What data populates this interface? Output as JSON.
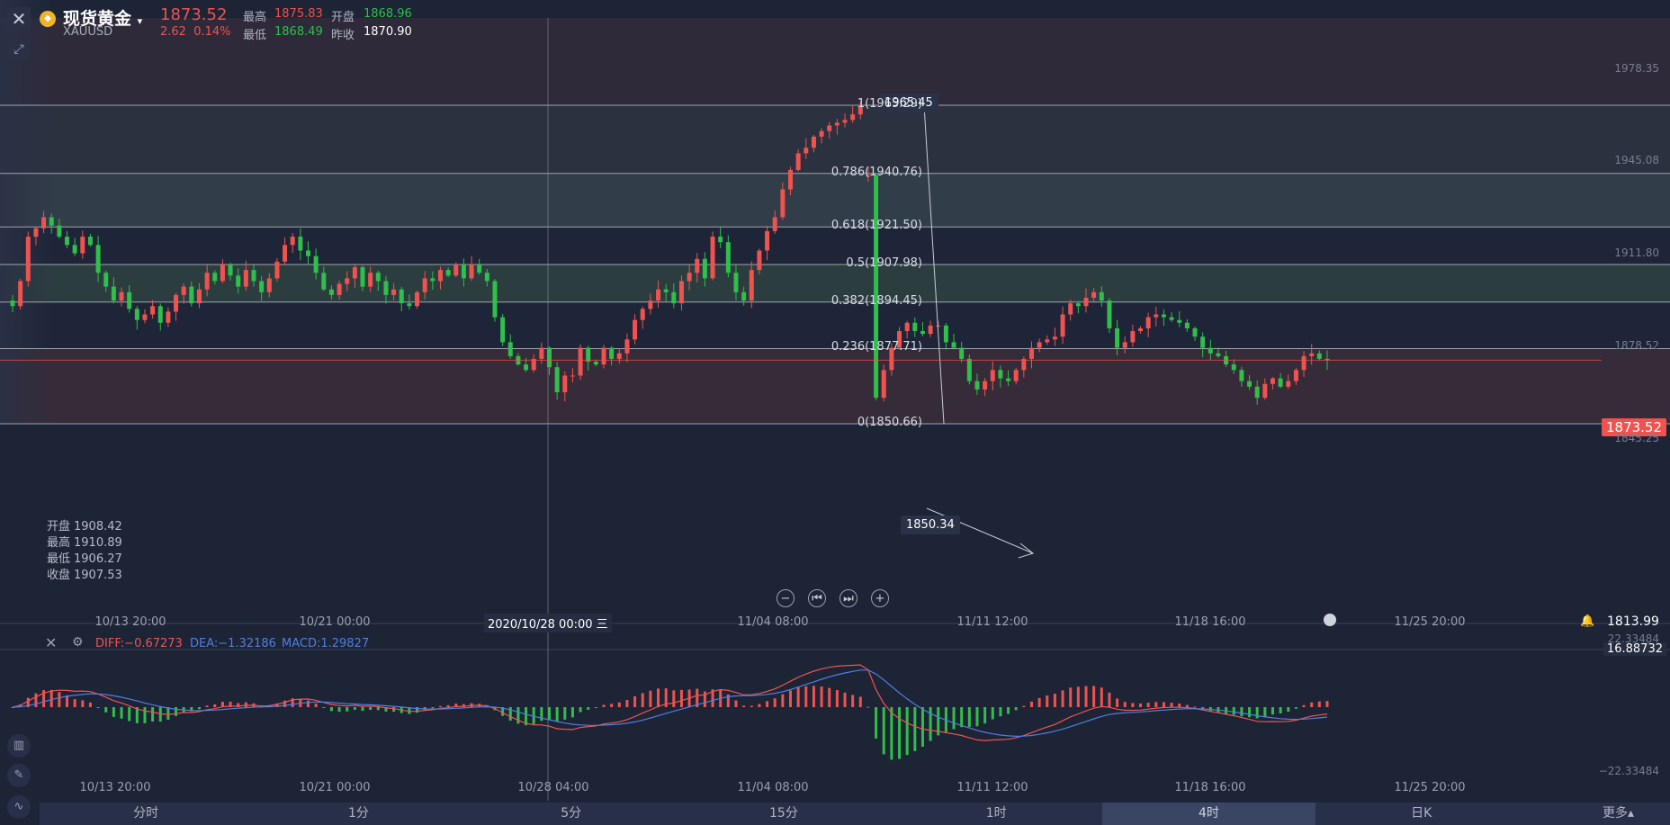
{
  "header": {
    "title": "现货黄金",
    "symbol": "XAUUSD",
    "price": "1873.52",
    "change": "2.62",
    "change_pct": "0.14%",
    "high_label": "最高",
    "high": "1875.83",
    "open_label": "开盘",
    "open": "1868.96",
    "low_label": "最低",
    "low": "1868.49",
    "prevclose_label": "昨收",
    "prevclose": "1870.90"
  },
  "ohlc_panel": [
    {
      "label": "开盘",
      "value": "1908.42"
    },
    {
      "label": "最高",
      "value": "1910.89"
    },
    {
      "label": "最低",
      "value": "1906.27"
    },
    {
      "label": "收盘",
      "value": "1907.53"
    }
  ],
  "fib": {
    "high_box": "1965.45",
    "low_box": "1850.34",
    "levels": [
      {
        "label": "1(1965.29)",
        "value": 1965.29
      },
      {
        "label": "0.786(1940.76)",
        "value": 1940.76
      },
      {
        "label": "0.618(1921.50)",
        "value": 1921.5
      },
      {
        "label": "0.5(1907.98)",
        "value": 1907.98
      },
      {
        "label": "0.382(1894.45)",
        "value": 1894.45
      },
      {
        "label": "0.236(1877.71)",
        "value": 1877.71
      },
      {
        "label": "0(1850.66)",
        "value": 1850.66
      }
    ]
  },
  "y_axis": [
    "1978.35",
    "1945.08",
    "1911.80",
    "1878.52",
    "1845.25"
  ],
  "current_price_tag": "1873.52",
  "crosshair": {
    "date_label": "2020/10/28 00:00 三",
    "y_value": "1813.99"
  },
  "x_axis_main": [
    "10/13 20:00",
    "10/21 00:00",
    "11/04 08:00",
    "11/11 12:00",
    "11/18 16:00",
    "11/25 20:00"
  ],
  "x_axis_macd": [
    "10/13 20:00",
    "10/21 00:00",
    "10/28 04:00",
    "11/04 08:00",
    "11/11 12:00",
    "11/18 16:00",
    "11/25 20:00"
  ],
  "macd": {
    "diff": "DIFF:−0.67273",
    "dea": "DEA:−1.32186",
    "macd": "MACD:1.29827",
    "top_label": "22.33484",
    "cursor_tag": "16.88732",
    "bottom_label": "−22.33484"
  },
  "tabs": [
    "分时",
    "1分",
    "5分",
    "15分",
    "1时",
    "4时",
    "日K",
    "更多▴"
  ],
  "active_tab": "4时",
  "colors": {
    "up": "#ef5350",
    "down": "#2fbf4a",
    "bg": "#1d2436",
    "diff": "#ef5350",
    "dea": "#4f7fe0"
  },
  "chart_data": {
    "type": "candlestick",
    "title": "现货黄金 XAUUSD",
    "ylim": [
      1830,
      1985
    ],
    "closes": [
      1893,
      1902,
      1918,
      1921,
      1925,
      1922,
      1918,
      1915,
      1912,
      1918,
      1915,
      1905,
      1900,
      1895,
      1898,
      1892,
      1888,
      1890,
      1893,
      1887,
      1891,
      1897,
      1900,
      1894,
      1899,
      1905,
      1902,
      1908,
      1904,
      1900,
      1906,
      1902,
      1898,
      1903,
      1909,
      1915,
      1918,
      1913,
      1911,
      1905,
      1899,
      1897,
      1901,
      1903,
      1907,
      1900,
      1905,
      1902,
      1897,
      1899,
      1894,
      1893,
      1898,
      1903,
      1902,
      1906,
      1904,
      1908,
      1903,
      1908,
      1905,
      1902,
      1889,
      1880,
      1875,
      1872,
      1870,
      1874,
      1878,
      1871,
      1862,
      1868,
      1868,
      1878,
      1873,
      1872,
      1878,
      1874,
      1876,
      1881,
      1888,
      1892,
      1895,
      1899,
      1898,
      1894,
      1902,
      1905,
      1910,
      1903,
      1918,
      1916,
      1905,
      1898,
      1895,
      1906,
      1913,
      1920,
      1925,
      1935,
      1942,
      1948,
      1950,
      1954,
      1956,
      1958,
      1959,
      1960,
      1962,
      1965,
      1940,
      1860,
      1870,
      1878,
      1884,
      1887,
      1884,
      1883,
      1886,
      1886,
      1880,
      1878,
      1874,
      1866,
      1863,
      1866,
      1870,
      1867,
      1866,
      1870,
      1874,
      1878,
      1880,
      1881,
      1882,
      1890,
      1894,
      1893,
      1896,
      1898,
      1895,
      1885,
      1878,
      1880,
      1884,
      1885,
      1889,
      1890,
      1889,
      1888,
      1887,
      1885,
      1882,
      1878,
      1876,
      1875,
      1872,
      1870,
      1866,
      1864,
      1860,
      1865,
      1867,
      1864,
      1866,
      1870,
      1875,
      1876,
      1874,
      1873.52
    ]
  }
}
